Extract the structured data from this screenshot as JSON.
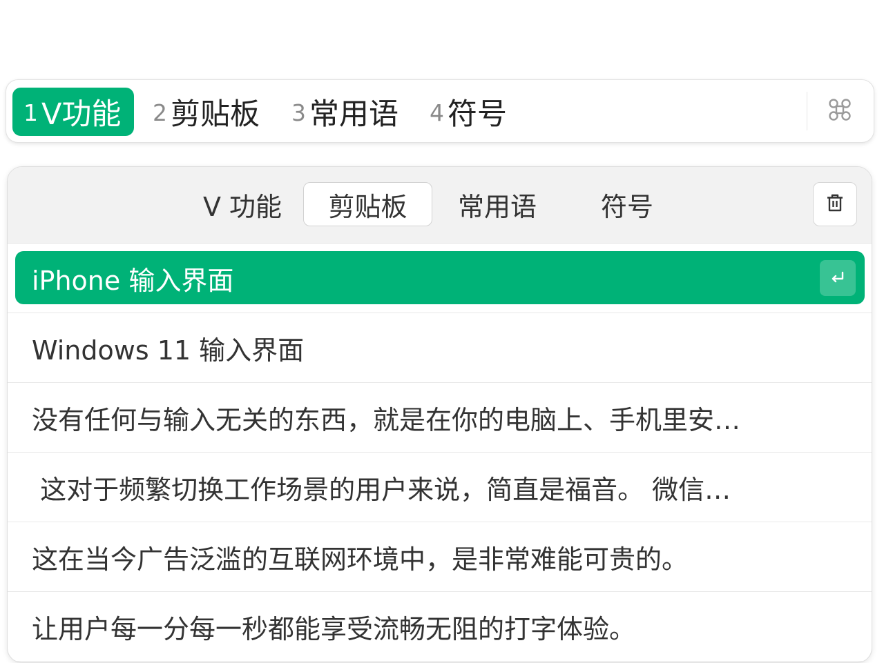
{
  "colors": {
    "accent": "#00b277",
    "panel_header": "#f2f2f2",
    "text": "#333333"
  },
  "candidate_bar": {
    "candidates": [
      {
        "index": "1",
        "text": "V功能",
        "selected": true
      },
      {
        "index": "2",
        "text": "剪贴板",
        "selected": false
      },
      {
        "index": "3",
        "text": "常用语",
        "selected": false
      },
      {
        "index": "4",
        "text": "符号",
        "selected": false
      }
    ],
    "menu_icon": "command-icon"
  },
  "panel": {
    "tabs": [
      {
        "label": "V 功能",
        "active": false
      },
      {
        "label": "剪贴板",
        "active": true
      },
      {
        "label": "常用语",
        "active": false
      },
      {
        "label": "符号",
        "active": false
      }
    ],
    "trash_icon": "trash-icon",
    "items": [
      {
        "text": "iPhone 输入界面",
        "selected": true
      },
      {
        "text": "Windows 11 输入界面",
        "selected": false
      },
      {
        "text": "没有任何与输入无关的东西，就是在你的电脑上、手机里安…",
        "selected": false
      },
      {
        "text": " 这对于频繁切换工作场景的用户来说，简直是福音。 微信…",
        "selected": false
      },
      {
        "text": "这在当今广告泛滥的互联网环境中，是非常难能可贵的。",
        "selected": false
      },
      {
        "text": "让用户每一分每一秒都能享受流畅无阻的打字体验。",
        "selected": false
      }
    ],
    "enter_icon": "enter-icon"
  }
}
